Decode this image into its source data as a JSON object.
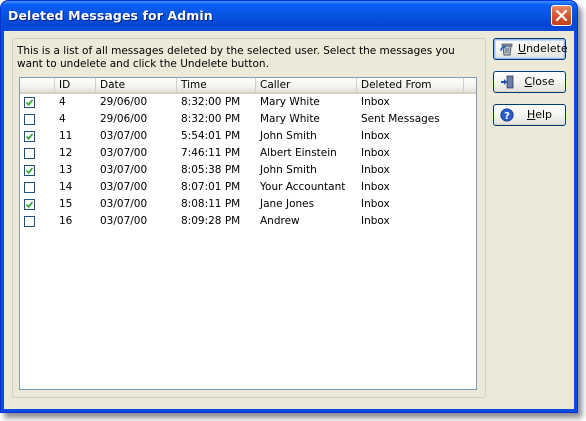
{
  "window": {
    "title": "Deleted Messages for Admin"
  },
  "description": "This is a list of all messages deleted by the selected user.  Select the messages you want to undelete and click the Undelete button.",
  "table": {
    "columns": [
      "",
      "ID",
      "Date",
      "Time",
      "Caller",
      "Deleted From"
    ],
    "rows": [
      {
        "checked": true,
        "id": "4",
        "date": "29/06/00",
        "time": "8:32:00 PM",
        "caller": "Mary White",
        "deleted_from": "Inbox"
      },
      {
        "checked": false,
        "id": "4",
        "date": "29/06/00",
        "time": "8:32:00 PM",
        "caller": "Mary White",
        "deleted_from": "Sent Messages"
      },
      {
        "checked": true,
        "id": "11",
        "date": "03/07/00",
        "time": "5:54:01 PM",
        "caller": "John Smith",
        "deleted_from": "Inbox"
      },
      {
        "checked": false,
        "id": "12",
        "date": "03/07/00",
        "time": "7:46:11 PM",
        "caller": "Albert Einstein",
        "deleted_from": "Inbox"
      },
      {
        "checked": true,
        "id": "13",
        "date": "03/07/00",
        "time": "8:05:38 PM",
        "caller": "John Smith",
        "deleted_from": "Inbox"
      },
      {
        "checked": false,
        "id": "14",
        "date": "03/07/00",
        "time": "8:07:01 PM",
        "caller": "Your Accountant",
        "deleted_from": "Inbox"
      },
      {
        "checked": true,
        "id": "15",
        "date": "03/07/00",
        "time": "8:08:11 PM",
        "caller": "Jane Jones",
        "deleted_from": "Inbox"
      },
      {
        "checked": false,
        "id": "16",
        "date": "03/07/00",
        "time": "8:09:28 PM",
        "caller": "Andrew",
        "deleted_from": "Inbox"
      }
    ]
  },
  "buttons": {
    "undelete": {
      "mnemonic": "U",
      "rest": "ndelete",
      "icon": "undelete-icon"
    },
    "close": {
      "mnemonic": "C",
      "rest": "lose",
      "icon": "exit-door-icon"
    },
    "help": {
      "mnemonic": "H",
      "rest": "elp",
      "icon": "help-question-icon"
    }
  },
  "colors": {
    "titlebar": "#0754e2",
    "client": "#ece9d8",
    "list_border": "#7f9db9",
    "close_button": "#d8562f"
  }
}
